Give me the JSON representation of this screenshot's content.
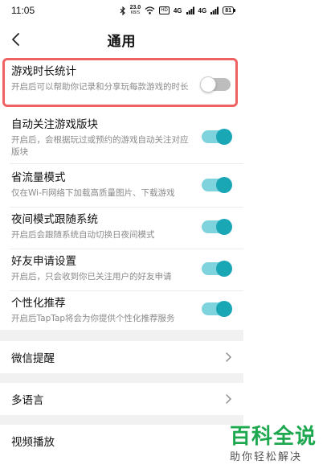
{
  "status_bar": {
    "time": "11:05",
    "net_speed": "23.0",
    "net_unit": "KB/S",
    "hd": "HD",
    "signal_1": "4G",
    "signal_2": "4G",
    "battery": "81"
  },
  "header": {
    "title": "通用",
    "back_icon": "chevron-left-icon"
  },
  "settings": [
    {
      "label": "游戏时长统计",
      "desc": "开启后可以帮助你记录和分享玩每款游戏的时长",
      "enabled": false,
      "highlighted": true
    },
    {
      "label": "自动关注游戏版块",
      "desc": "开启后，会根据玩过或预约的游戏自动关注对应版块",
      "enabled": true
    },
    {
      "label": "省流量模式",
      "desc": "仅在Wi-Fi网络下加载高质量图片、下载游戏",
      "enabled": true
    },
    {
      "label": "夜间模式跟随系统",
      "desc": "开启后会跟随系统自动切换日夜间模式",
      "enabled": true
    },
    {
      "label": "好友申请设置",
      "desc": "开启后，只会收到你已关注用户的好友申请",
      "enabled": true
    },
    {
      "label": "个性化推荐",
      "desc": "开启后TapTap将会为你提供个性化推荐服务",
      "enabled": true
    }
  ],
  "nav_items": [
    {
      "label": "微信提醒",
      "icon": "chevron-right-icon"
    },
    {
      "label": "多语言",
      "icon": "chevron-right-icon"
    },
    {
      "label": "视频播放"
    }
  ],
  "colors": {
    "toggle_on_track": "#7fd3dc",
    "toggle_on_knob": "#19a7b6",
    "toggle_off_track": "#bdbdbd",
    "highlight_border": "#f06262",
    "watermark_green": "#1da84f"
  },
  "watermark": {
    "main": "百科全说",
    "sub": "助你轻松解决"
  }
}
